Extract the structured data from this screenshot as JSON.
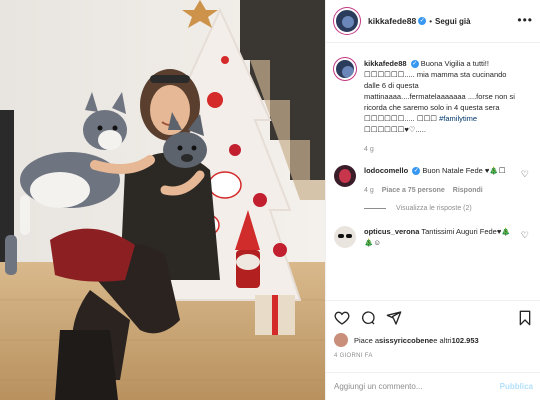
{
  "header": {
    "username": "kikkafede88",
    "verified_mark": "✓",
    "separator": "•",
    "follow_label": "Segui già",
    "more_icon": "more-horizontal-icon"
  },
  "caption": {
    "username": "kikkafede88",
    "verified_mark": "✓",
    "text": "Buona Vigilia a tutti!! ☐☐☐☐☐☐..... mia mamma sta cucinando dalle 6 di questa mattinaaaa....fermatelaaaaaaa ....forse non si ricorda che saremo solo in 4 questa sera ☐☐☐☐☐☐..... ☐☐☐ ",
    "hashtag": "#familytime",
    "tail": " ☐☐☐☐☐☐♥♡.....",
    "time": "4 g"
  },
  "comments": [
    {
      "username": "lodocomello",
      "verified_mark": "✓",
      "text": "Buon Natale Fede ♥🎄☐",
      "time": "4 g",
      "likes": "Piace a 75 persone",
      "reply_label": "Rispondi",
      "view_replies": "Visualizza le risposte (2)"
    },
    {
      "username": "opticus_verona",
      "text": "Tantissimi Auguri Fede♥🎄🎄☺"
    }
  ],
  "actions": {
    "like_icon": "heart-icon",
    "comment_icon": "comment-icon",
    "share_icon": "share-icon",
    "save_icon": "bookmark-icon"
  },
  "likes": {
    "prefix": "Piace a ",
    "first_user": "sissyriccobene",
    "suffix": " e altri ",
    "count": "102.953"
  },
  "date": "4 GIORNI FA",
  "add_comment": {
    "placeholder": "Aggiungi un commento...",
    "publish_label": "Pubblica"
  },
  "colors": {
    "accent_blue": "#3897f0",
    "publish_disabled": "#b2dffc",
    "muted": "#8e8e8e"
  }
}
